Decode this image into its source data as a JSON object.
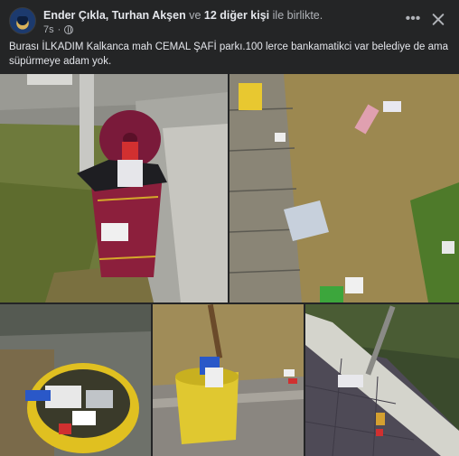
{
  "post": {
    "author_primary": "Ender Çıkla",
    "separator": ",",
    "author_secondary": "Turhan Akşen",
    "connector": "ve",
    "others": "12 diğer kişi",
    "suffix": "ile birlikte.",
    "time": "7s",
    "more_label": "•••",
    "text": "Burası İLKADIM Kalkanca mah CEMAL ŞAFİ parkı.100 lerce bankamatikci var belediye de ama süpürmeye adam yok."
  },
  "icons": {
    "avatar": "avatar",
    "globe": "globe-icon",
    "more": "more-horizontal-icon",
    "close": "close-icon"
  },
  "colors": {
    "background": "#242526",
    "text_primary": "#e4e6eb",
    "text_secondary": "#b0b3b8"
  },
  "photos": [
    {
      "id": "photo-1",
      "subject": "red trash bin overflowing on park path"
    },
    {
      "id": "photo-2",
      "subject": "litter on dry grass beside stone edging"
    },
    {
      "id": "photo-3",
      "subject": "yellow trash bin full of rubbish"
    },
    {
      "id": "photo-4",
      "subject": "yellow trash bin next to tree"
    },
    {
      "id": "photo-5",
      "subject": "litter on paved walkway by curb"
    }
  ]
}
